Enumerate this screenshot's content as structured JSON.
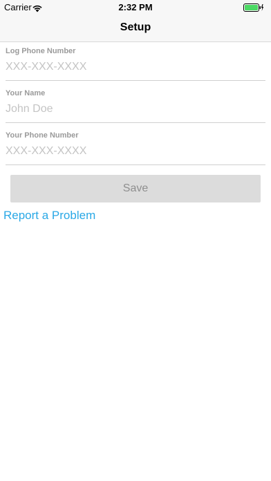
{
  "status_bar": {
    "carrier": "Carrier",
    "time": "2:32 PM",
    "wifi_icon": "wifi-icon",
    "battery_icon": "battery-charging-icon",
    "battery_color": "#4cd964"
  },
  "nav": {
    "title": "Setup"
  },
  "form": {
    "log_phone": {
      "label": "Log Phone Number",
      "placeholder": "XXX-XXX-XXXX",
      "value": ""
    },
    "your_name": {
      "label": "Your Name",
      "placeholder": "John Doe",
      "value": ""
    },
    "your_phone": {
      "label": "Your Phone Number",
      "placeholder": "XXX-XXX-XXXX",
      "value": ""
    },
    "save_label": "Save"
  },
  "links": {
    "report_problem": "Report a Problem",
    "link_color": "#29a8e6"
  }
}
